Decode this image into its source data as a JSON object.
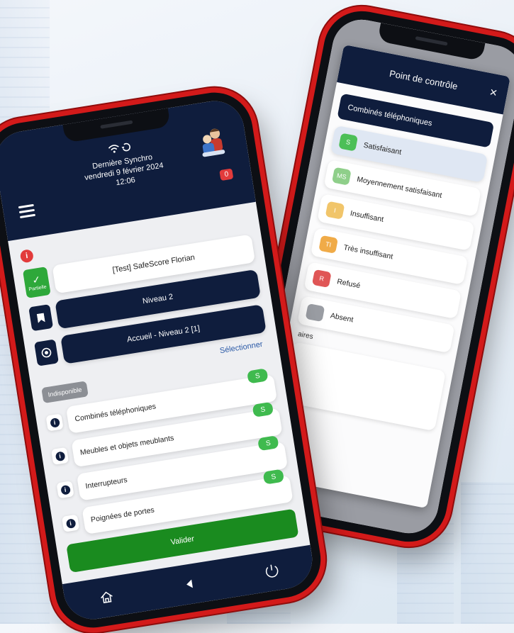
{
  "back": {
    "modal_title": "Point de contrôle",
    "close_glyph": "×",
    "section": "Combinés téléphoniques",
    "options": [
      {
        "code": "S",
        "label": "Satisfaisant",
        "color": "#4cbf57",
        "selected": true
      },
      {
        "code": "MS",
        "label": "Moyennement satisfaisant",
        "color": "#8fcf8a",
        "selected": false
      },
      {
        "code": "I",
        "label": "Insuffisant",
        "color": "#f1c56a",
        "selected": false
      },
      {
        "code": "TI",
        "label": "Très insuffisant",
        "color": "#f0ab48",
        "selected": false
      },
      {
        "code": "R",
        "label": "Refusé",
        "color": "#e05656",
        "selected": false
      },
      {
        "code": "",
        "label": "Absent",
        "color": "#9b9ea4",
        "selected": false
      }
    ],
    "comment_label": "aires"
  },
  "front": {
    "header": {
      "sync_title": "Dernière Synchro",
      "sync_date": "vendredi 9 février 2024",
      "sync_time": "12:06",
      "counter": "0"
    },
    "status_label": "Partielle",
    "site": "[Test] SafeScore Florian",
    "level": "Niveau 2",
    "zone": "Accueil - Niveau 2 [1]",
    "select_label": "Sélectionner",
    "unavailable": "Indisponible",
    "items": [
      {
        "label": "Combinés téléphoniques",
        "badge": "S"
      },
      {
        "label": "Meubles et objets meublants",
        "badge": "S"
      },
      {
        "label": "Interrupteurs",
        "badge": "S"
      },
      {
        "label": "Poignées de portes",
        "badge": "S"
      }
    ],
    "validate": "Valider",
    "nav": [
      "home-icon",
      "back-icon",
      "power-icon"
    ]
  }
}
